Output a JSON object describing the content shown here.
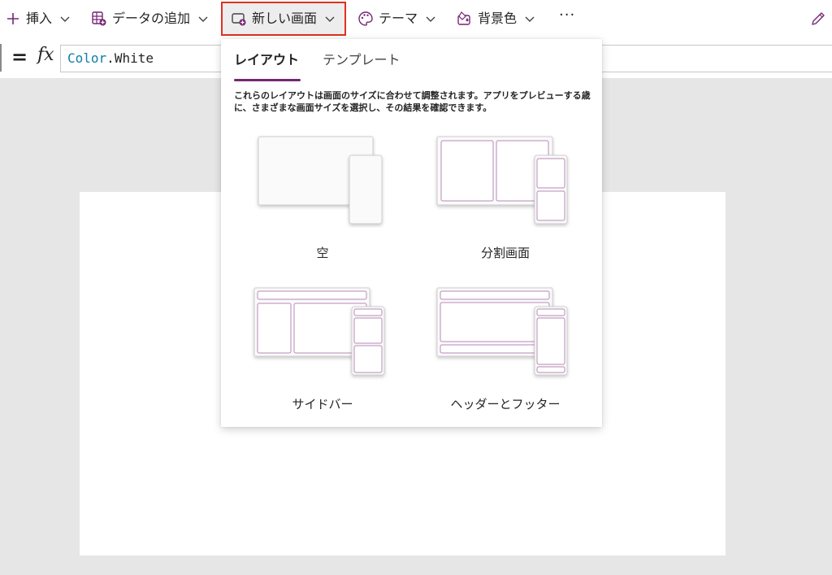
{
  "toolbar": {
    "insert_label": "挿入",
    "add_data_label": "データの追加",
    "new_screen_label": "新しい画面",
    "theme_label": "テーマ",
    "background_label": "背景色",
    "more_label": "···"
  },
  "formula": {
    "equals": "=",
    "fx": "fx",
    "object": "Color",
    "dot": ".",
    "member": "White"
  },
  "new_screen_panel": {
    "tabs": [
      {
        "label": "レイアウト",
        "selected": true
      },
      {
        "label": "テンプレート",
        "selected": false
      }
    ],
    "description": "これらのレイアウトは画面のサイズに合わせて調整されます。アプリをプレビューする歳に、さまざまな画面サイズを選択し、その結果を確認できます。",
    "layouts": [
      {
        "label": "空"
      },
      {
        "label": "分割画面"
      },
      {
        "label": "サイドバー"
      },
      {
        "label": "ヘッダーとフッター"
      }
    ]
  },
  "colors": {
    "accent": "#742774",
    "highlight_border": "#e0301e",
    "layout_line": "#b78ab7"
  }
}
